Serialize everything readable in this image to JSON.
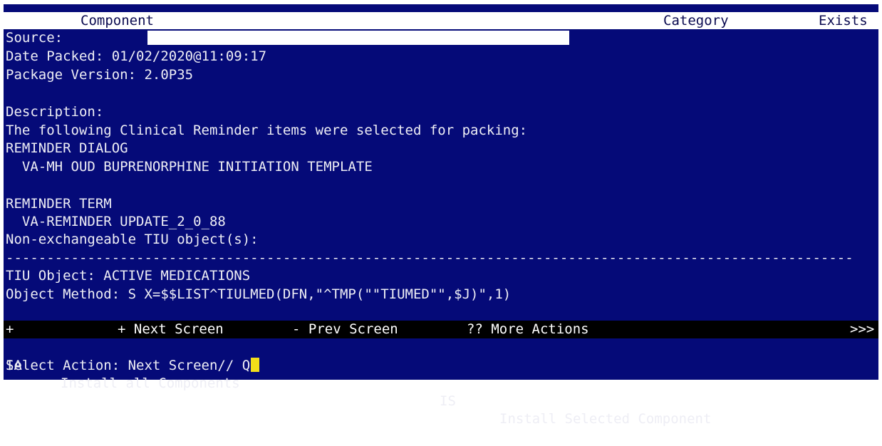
{
  "header": {
    "component": "Component",
    "category": "Category",
    "exists": "Exists"
  },
  "source_label": "Source:",
  "source_value": "",
  "lines": {
    "date_packed": "Date Packed: 01/02/2020@11:09:17",
    "package_version": "Package Version: 2.0P35",
    "description_label": "Description:",
    "description_text": "The following Clinical Reminder items were selected for packing:",
    "reminder_dialog_heading": "REMINDER DIALOG",
    "reminder_dialog_item": "  VA-MH OUD BUPRENORPHINE INITIATION TEMPLATE",
    "reminder_term_heading": "REMINDER TERM",
    "reminder_term_item": "  VA-REMINDER UPDATE_2_0_88",
    "non_exchangeable": "Non-exchangeable TIU object(s):",
    "separator": "--------------------------------------------------------------------------------------------------------",
    "tiu_object": "TIU Object: ACTIVE MEDICATIONS",
    "object_method": "Object Method: S X=$$LIST^TIULMED(DFN,\"^TMP(\"\"TIUMED\"\",$J)\",1)"
  },
  "menu_bar": {
    "plus": "+",
    "next_screen": "+ Next Screen",
    "prev_screen": "- Prev Screen",
    "more_actions": "?? More Actions",
    "more_indicator": ">>>"
  },
  "actions": {
    "ia_code": "IA",
    "ia_label": "Install all Components",
    "is_code": "IS",
    "is_label": "Install Selected Component"
  },
  "prompt": {
    "label": "Select Action: Next Screen// ",
    "input": "Q"
  },
  "colors": {
    "background": "#050a78",
    "text": "#eeeef5",
    "header_bg": "#ffffff",
    "menu_bg": "#000000",
    "cursor": "#f2de1a"
  }
}
